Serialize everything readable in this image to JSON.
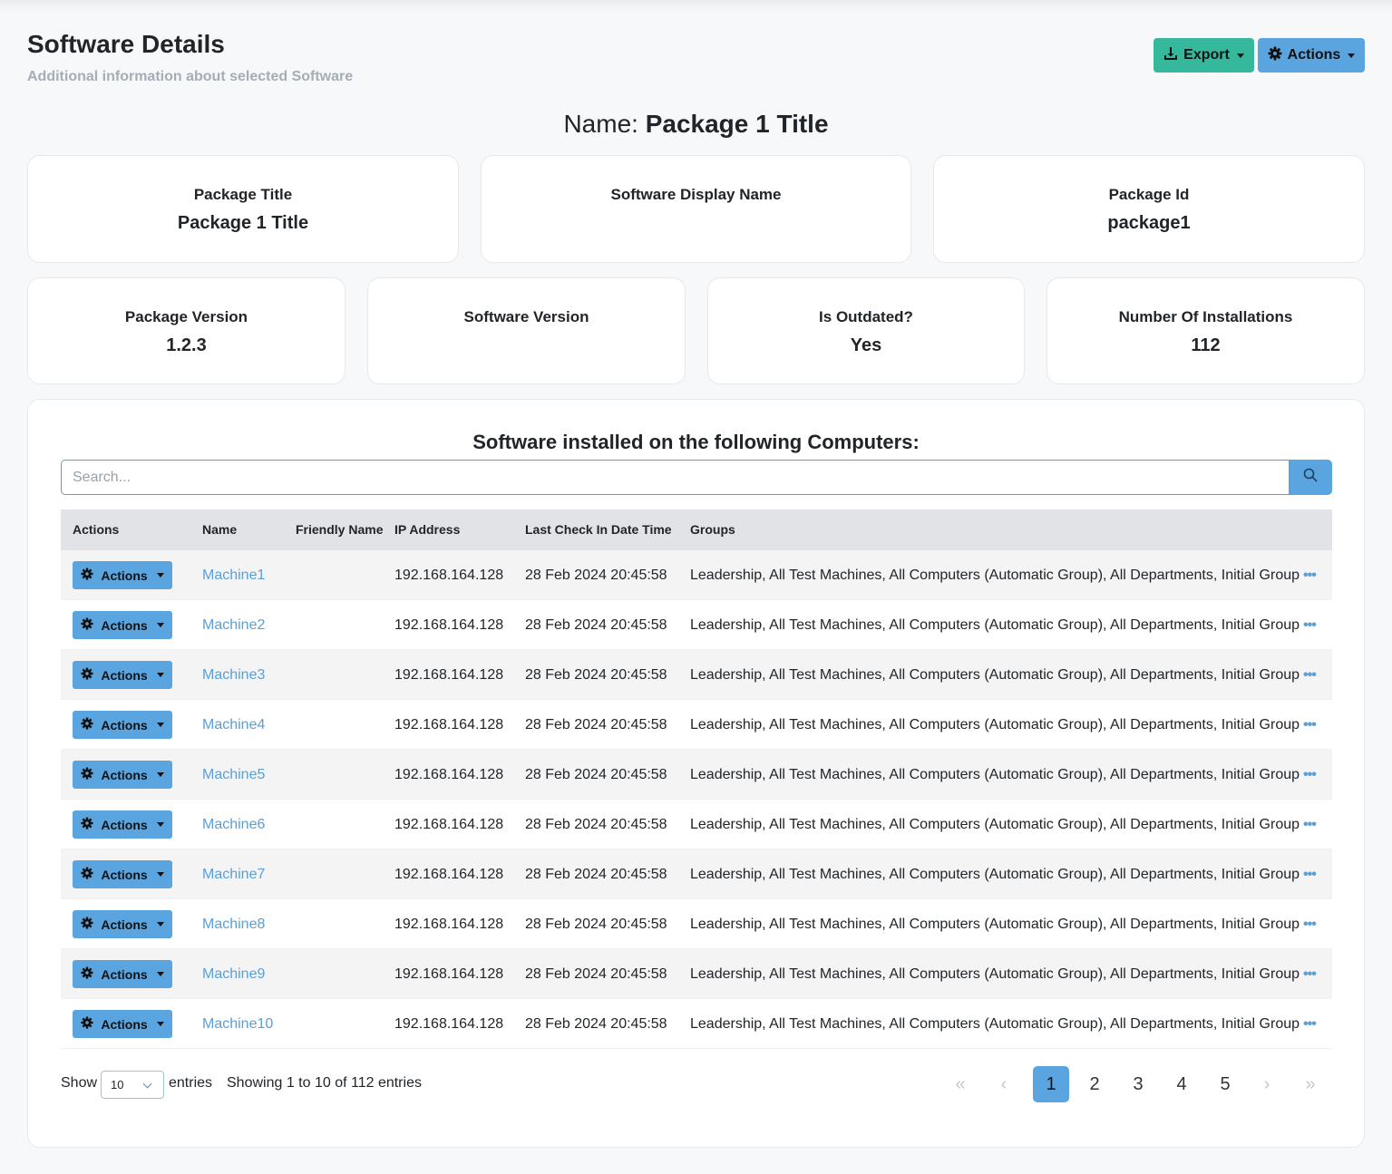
{
  "header": {
    "title": "Software Details",
    "subtitle": "Additional information about selected Software",
    "export_label": "Export",
    "actions_label": "Actions"
  },
  "name_heading": {
    "prefix": "Name:",
    "value": "Package 1 Title"
  },
  "cards_top": [
    {
      "label": "Package Title",
      "value": "Package 1 Title"
    },
    {
      "label": "Software Display Name",
      "value": ""
    },
    {
      "label": "Package Id",
      "value": "package1"
    }
  ],
  "cards_bottom": [
    {
      "label": "Package Version",
      "value": "1.2.3"
    },
    {
      "label": "Software Version",
      "value": ""
    },
    {
      "label": "Is Outdated?",
      "value": "Yes"
    },
    {
      "label": "Number Of Installations",
      "value": "112"
    }
  ],
  "computers": {
    "title": "Software installed on the following Computers:",
    "search_placeholder": "Search...",
    "columns": [
      "Actions",
      "Name",
      "Friendly Name",
      "IP Address",
      "Last Check In Date Time",
      "Groups"
    ],
    "row_action_label": "Actions",
    "rows": [
      {
        "name": "Machine1",
        "friendly_name": "",
        "ip": "192.168.164.128",
        "last_check_in": "28 Feb 2024 20:45:58",
        "groups": "Leadership, All Test Machines, All Computers (Automatic Group), All Departments, Initial Group"
      },
      {
        "name": "Machine2",
        "friendly_name": "",
        "ip": "192.168.164.128",
        "last_check_in": "28 Feb 2024 20:45:58",
        "groups": "Leadership, All Test Machines, All Computers (Automatic Group), All Departments, Initial Group"
      },
      {
        "name": "Machine3",
        "friendly_name": "",
        "ip": "192.168.164.128",
        "last_check_in": "28 Feb 2024 20:45:58",
        "groups": "Leadership, All Test Machines, All Computers (Automatic Group), All Departments, Initial Group"
      },
      {
        "name": "Machine4",
        "friendly_name": "",
        "ip": "192.168.164.128",
        "last_check_in": "28 Feb 2024 20:45:58",
        "groups": "Leadership, All Test Machines, All Computers (Automatic Group), All Departments, Initial Group"
      },
      {
        "name": "Machine5",
        "friendly_name": "",
        "ip": "192.168.164.128",
        "last_check_in": "28 Feb 2024 20:45:58",
        "groups": "Leadership, All Test Machines, All Computers (Automatic Group), All Departments, Initial Group"
      },
      {
        "name": "Machine6",
        "friendly_name": "",
        "ip": "192.168.164.128",
        "last_check_in": "28 Feb 2024 20:45:58",
        "groups": "Leadership, All Test Machines, All Computers (Automatic Group), All Departments, Initial Group"
      },
      {
        "name": "Machine7",
        "friendly_name": "",
        "ip": "192.168.164.128",
        "last_check_in": "28 Feb 2024 20:45:58",
        "groups": "Leadership, All Test Machines, All Computers (Automatic Group), All Departments, Initial Group"
      },
      {
        "name": "Machine8",
        "friendly_name": "",
        "ip": "192.168.164.128",
        "last_check_in": "28 Feb 2024 20:45:58",
        "groups": "Leadership, All Test Machines, All Computers (Automatic Group), All Departments, Initial Group"
      },
      {
        "name": "Machine9",
        "friendly_name": "",
        "ip": "192.168.164.128",
        "last_check_in": "28 Feb 2024 20:45:58",
        "groups": "Leadership, All Test Machines, All Computers (Automatic Group), All Departments, Initial Group"
      },
      {
        "name": "Machine10",
        "friendly_name": "",
        "ip": "192.168.164.128",
        "last_check_in": "28 Feb 2024 20:45:58",
        "groups": "Leadership, All Test Machines, All Computers (Automatic Group), All Departments, Initial Group"
      }
    ],
    "groups_more": "•••"
  },
  "footer": {
    "show_label": "Show",
    "page_size": "10",
    "entries_label": "entries",
    "info": "Showing 1 to 10 of 112 entries",
    "first_label": "«",
    "prev_label": "‹",
    "pages": [
      "1",
      "2",
      "3",
      "4",
      "5"
    ],
    "active_page": "1",
    "next_label": "›",
    "last_label": "»"
  },
  "colors": {
    "export_button": "#36b89c",
    "primary_button": "#5aa5e0",
    "link": "#5a9fd6",
    "header_row": "#e1e3e7"
  },
  "icons": {
    "export": "download-icon",
    "actions": "gear-icon",
    "search": "search-icon"
  }
}
